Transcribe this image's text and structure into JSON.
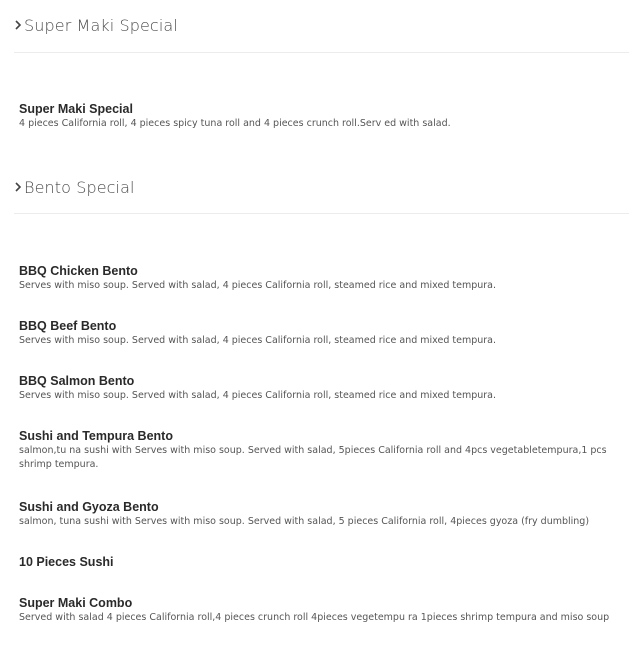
{
  "sections": [
    {
      "title": "Super Maki Special",
      "items": [
        {
          "name": "Super Maki Special",
          "description": "4 pieces California roll, 4 pieces spicy tuna roll and 4 pieces crunch roll.Serv ed with salad."
        }
      ]
    },
    {
      "title": "Bento Special",
      "items": [
        {
          "name": "BBQ Chicken Bento",
          "description": "Serves with miso soup. Served with salad, 4 pieces California roll, steamed rice and mixed tempura."
        },
        {
          "name": "BBQ Beef Bento",
          "description": "Serves with miso soup. Served with salad, 4 pieces California roll, steamed rice and mixed tempura."
        },
        {
          "name": "BBQ Salmon Bento",
          "description": "Serves with miso soup. Served with salad, 4 pieces California roll, steamed rice and mixed tempura."
        },
        {
          "name": "Sushi and Tempura Bento",
          "description": "salmon,tu na sushi with Serves with miso soup. Served with salad, 5pieces California roll and 4pcs vegetabletempura,1 pcs shrimp tempura."
        },
        {
          "name": "Sushi and Gyoza Bento",
          "description": "salmon, tuna sushi with Serves with miso soup. Served with salad, 5 pieces California roll, 4pieces gyoza (fry dumbling)"
        },
        {
          "name": "10 Pieces Sushi",
          "description": ""
        },
        {
          "name": "Super Maki Combo",
          "description": "Served with salad 4 pieces California roll,4 pieces crunch roll 4pieces vegetempu ra 1pieces shrimp tempura and miso soup"
        }
      ]
    }
  ]
}
